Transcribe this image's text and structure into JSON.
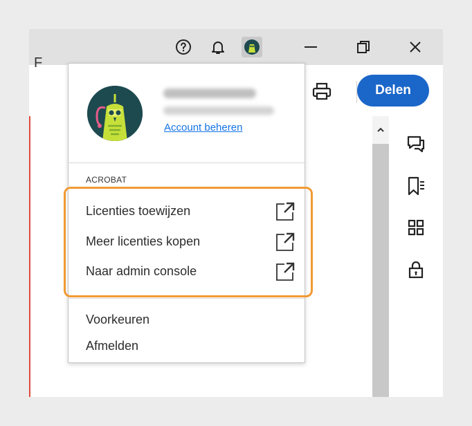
{
  "toolbar": {
    "partial_label": "F",
    "share_label": "Delen"
  },
  "menu": {
    "account_link": "Account beheren",
    "section_label": "ACROBAT",
    "items": [
      {
        "label": "Licenties toewijzen",
        "icon": "external-link-icon"
      },
      {
        "label": "Meer licenties kopen",
        "icon": "external-link-icon"
      },
      {
        "label": "Naar admin console",
        "icon": "external-link-icon"
      }
    ],
    "preferences_label": "Voorkeuren",
    "signout_label": "Afmelden"
  },
  "icons": {
    "titlebar": [
      "help-icon",
      "bell-icon",
      "avatar",
      "minimize-icon",
      "restore-icon",
      "close-icon"
    ],
    "rail": [
      "comment-icon",
      "bookmark-icon",
      "grid-icon",
      "lock-icon"
    ]
  },
  "colors": {
    "accent": "#1b66c9",
    "link": "#1473e6",
    "highlight": "#f19a33",
    "doc_edge": "#e0493c"
  }
}
